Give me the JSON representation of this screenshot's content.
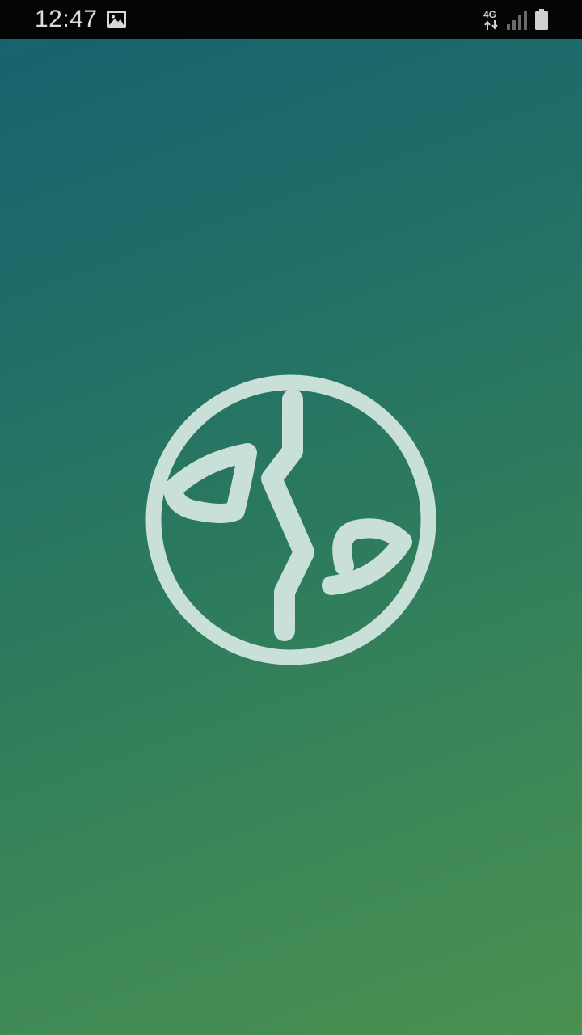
{
  "status_bar": {
    "time": "12:47",
    "network_type": "4G",
    "icons": {
      "notification": "image-icon",
      "data": "data-arrows-icon",
      "signal": "signal-icon",
      "battery": "battery-icon"
    }
  },
  "splash": {
    "logo_icon": "globe-icon",
    "colors": {
      "gradient_top": "#17636f",
      "gradient_bottom": "#4a9150",
      "logo": "#c9e0d9"
    }
  }
}
